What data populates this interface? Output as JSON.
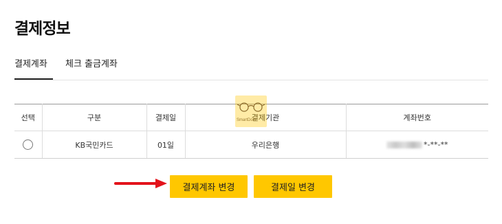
{
  "page": {
    "title": "결제정보"
  },
  "tabs": [
    {
      "label": "결제계좌",
      "active": true
    },
    {
      "label": "체크 출금계좌",
      "active": false
    }
  ],
  "table": {
    "headers": [
      "선택",
      "구분",
      "결제일",
      "결제기관",
      "계좌번호"
    ],
    "rows": [
      {
        "type": "KB국민카드",
        "pay_day": "01일",
        "institution": "우리은행",
        "account_suffix": "*-**-**",
        "selected": false
      }
    ]
  },
  "buttons": {
    "change_account": "결제계좌 변경",
    "change_date": "결제일 변경"
  },
  "watermark": {
    "text": "SmartDoct"
  },
  "colors": {
    "accent": "#ffc700",
    "arrow": "#e3131b"
  }
}
